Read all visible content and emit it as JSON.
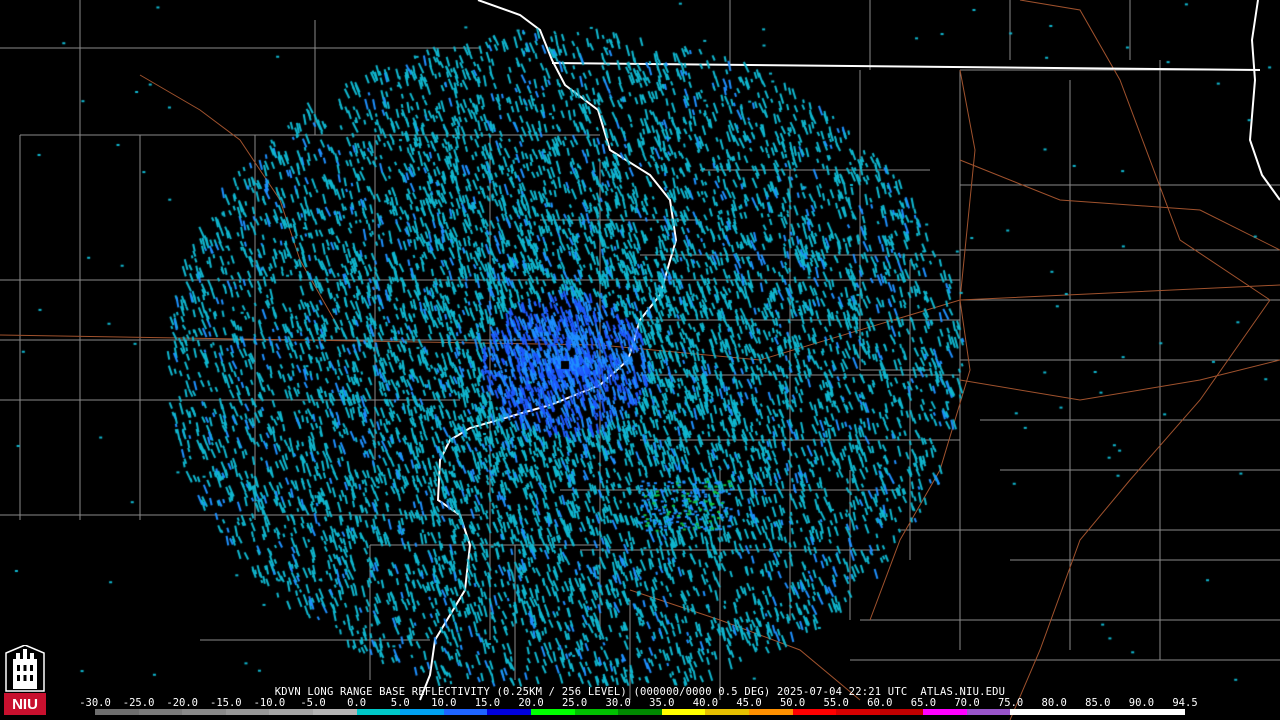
{
  "product_title": "KDVN LONG RANGE BASE REFLECTIVITY (0.25KM / 256 LEVEL) (000000/0000 0.5 DEG) 2025-07-04 22:21 UTC  ATLAS.NIU.EDU",
  "legend": {
    "ticks": [
      "-30.0",
      "-25.0",
      "-20.0",
      "-15.0",
      "-10.0",
      "-5.0",
      "0.0",
      "5.0",
      "10.0",
      "15.0",
      "20.0",
      "25.0",
      "30.0",
      "35.0",
      "40.0",
      "45.0",
      "50.0",
      "55.0",
      "60.0",
      "65.0",
      "70.0",
      "75.0",
      "80.0",
      "85.0",
      "90.0",
      "94.5"
    ],
    "colors": [
      "#6e6e6e",
      "#7a7a7a",
      "#888888",
      "#969696",
      "#a4a4a4",
      "#b4b4b4",
      "#00c8c8",
      "#00a0f0",
      "#1e64ff",
      "#0000dc",
      "#00ff00",
      "#00c000",
      "#008800",
      "#ffff00",
      "#e6c000",
      "#ff9000",
      "#ff0000",
      "#d60000",
      "#c00000",
      "#ff00ff",
      "#9955c9",
      "#ffffff",
      "#ffffff",
      "#ffffff",
      "#ffffff"
    ]
  },
  "logo": {
    "text": "NIU",
    "color": "#c8102e"
  },
  "map_colors": {
    "county": "#8a8a8a",
    "state": "#ffffff",
    "highway": "#a0522d",
    "echo_light": "#10b8d0",
    "echo_mid": "#1e90ff",
    "echo_blue": "#1e5aff",
    "echo_green": "#10c040"
  }
}
